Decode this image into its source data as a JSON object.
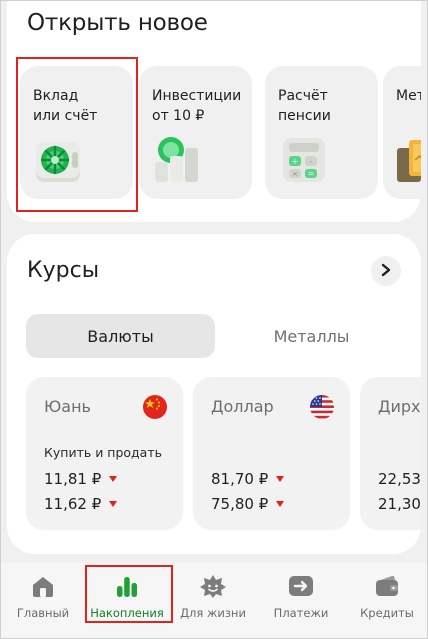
{
  "open_new": {
    "title": "Открыть новое",
    "products": [
      {
        "label": "Вклад\nили счёт",
        "icon": "safe-icon"
      },
      {
        "label": "Инвестиции\nот 10 ₽",
        "icon": "investments-chart-icon"
      },
      {
        "label": "Расчёт\nпенсии",
        "icon": "calculator-icon"
      },
      {
        "label": "Мета",
        "icon": "gold-bars-icon"
      }
    ]
  },
  "rates": {
    "title": "Курсы",
    "tabs": {
      "currencies": "Валюты",
      "metals": "Металлы"
    },
    "cards": [
      {
        "currency": "Юань",
        "flag": "china-flag",
        "buy_sell_label": "Купить и продать",
        "rate1": "11,81 ₽",
        "rate2": "11,62 ₽"
      },
      {
        "currency": "Доллар",
        "flag": "usa-flag",
        "rate1": "81,70 ₽",
        "rate2": "75,80 ₽"
      },
      {
        "currency": "Дирха",
        "rate1": "22,53",
        "rate2": "21,30"
      }
    ]
  },
  "nav": {
    "items": [
      {
        "label": "Главный",
        "icon": "home-icon"
      },
      {
        "label": "Накопления",
        "icon": "savings-bars-icon",
        "active": true
      },
      {
        "label": "Для жизни",
        "icon": "lifestyle-icon"
      },
      {
        "label": "Платежи",
        "icon": "payments-arrow-icon"
      },
      {
        "label": "Кредиты",
        "icon": "wallet-icon"
      }
    ]
  },
  "colors": {
    "accent_green": "#21a038",
    "active_green": "#107f2a",
    "highlight_red": "#e2231a",
    "down_arrow_red": "#e2231a"
  }
}
